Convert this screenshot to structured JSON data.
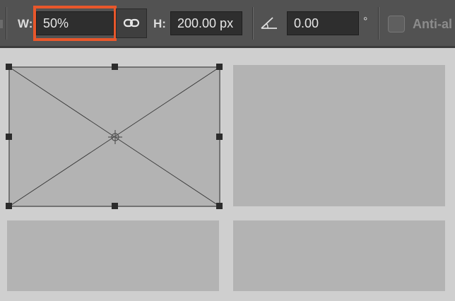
{
  "toolbar": {
    "width_label": "W:",
    "width_value": "50%",
    "height_label": "H:",
    "height_value": "200.00 px",
    "angle_value": "0.00",
    "degree_symbol": "°",
    "anti_alias_label": "Anti-al",
    "anti_alias_checked": false,
    "highlight_color": "#e8572b",
    "icons": {
      "link": "link-chain-icon",
      "angle": "angle-icon",
      "reference_point": "crosshair-reference-point-icon"
    }
  }
}
